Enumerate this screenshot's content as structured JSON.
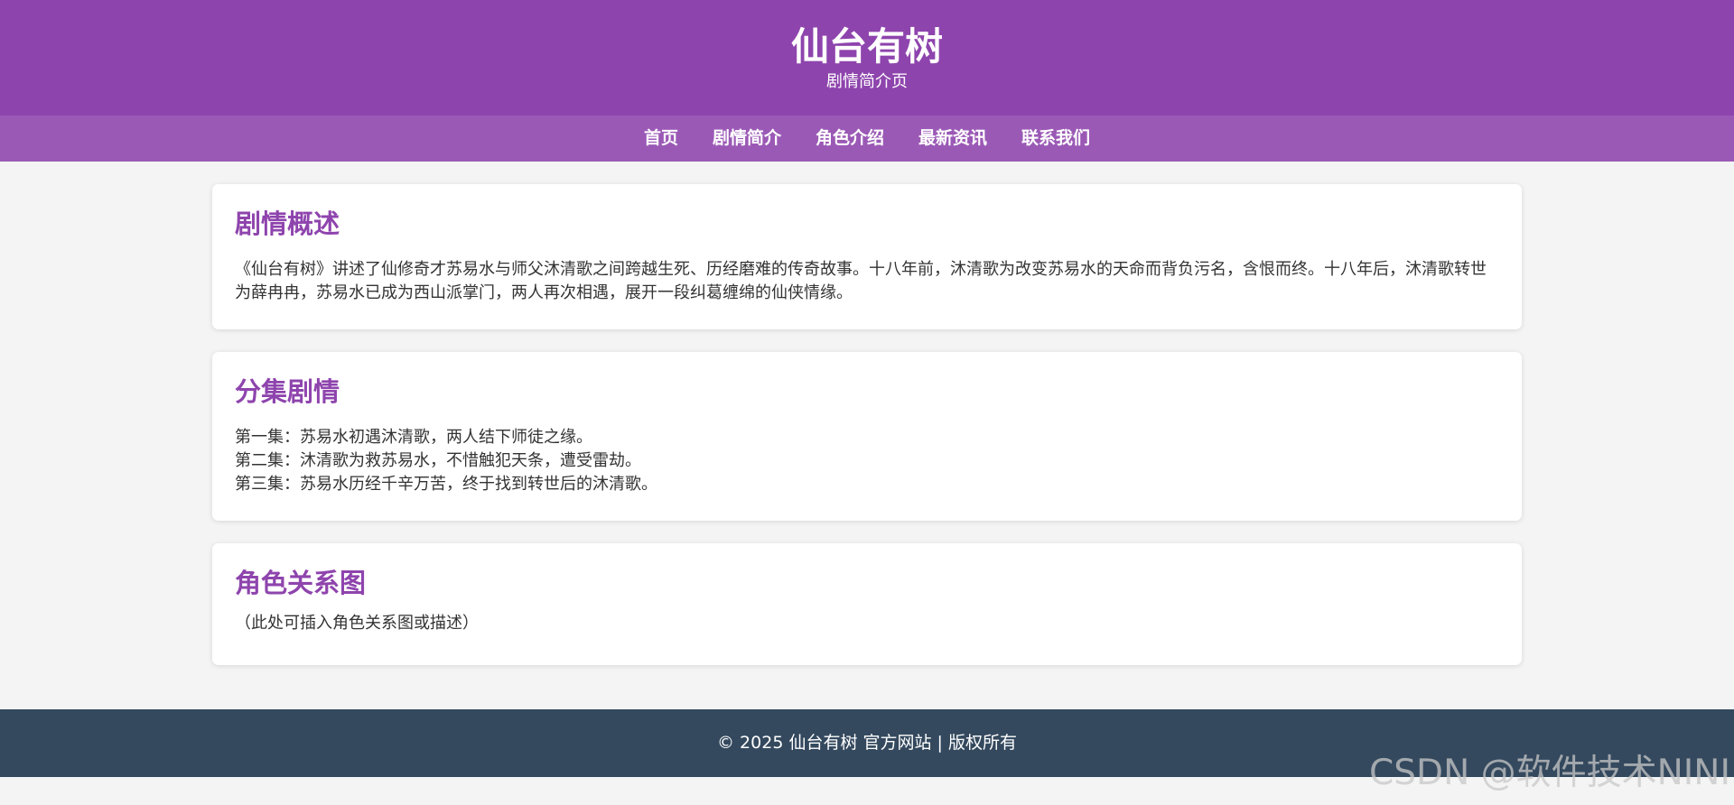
{
  "header": {
    "title": "仙台有树",
    "subtitle": "剧情简介页"
  },
  "nav": {
    "items": [
      {
        "label": "首页"
      },
      {
        "label": "剧情简介"
      },
      {
        "label": "角色介绍"
      },
      {
        "label": "最新资讯"
      },
      {
        "label": "联系我们"
      }
    ]
  },
  "sections": {
    "overview": {
      "title": "剧情概述",
      "text": "《仙台有树》讲述了仙修奇才苏易水与师父沐清歌之间跨越生死、历经磨难的传奇故事。十八年前，沐清歌为改变苏易水的天命而背负污名，含恨而终。十八年后，沐清歌转世为薛冉冉，苏易水已成为西山派掌门，两人再次相遇，展开一段纠葛缠绵的仙侠情缘。"
    },
    "episodes": {
      "title": "分集剧情",
      "items": [
        "第一集：苏易水初遇沐清歌，两人结下师徒之缘。",
        "第二集：沐清歌为救苏易水，不惜触犯天条，遭受雷劫。",
        "第三集：苏易水历经千辛万苦，终于找到转世后的沐清歌。"
      ]
    },
    "relations": {
      "title": "角色关系图",
      "text": "（此处可插入角色关系图或描述）"
    }
  },
  "footer": {
    "text": "© 2025 仙台有树 官方网站 | 版权所有"
  },
  "watermark": "CSDN @软件技术NINI",
  "colors": {
    "header_bg": "#8e44ad",
    "nav_bg": "#9b59b6",
    "footer_bg": "#34495e",
    "page_bg": "#f4f4f4",
    "heading": "#8e44ad"
  }
}
